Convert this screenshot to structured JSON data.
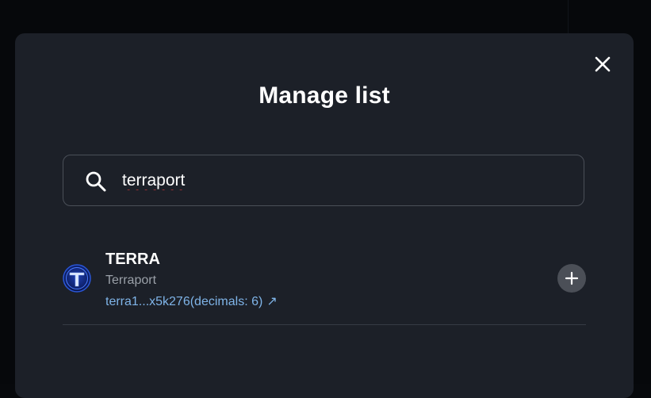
{
  "modal": {
    "title": "Manage list",
    "close_icon": "close-icon"
  },
  "search": {
    "value": "terraport",
    "icon": "search-icon"
  },
  "results": [
    {
      "symbol": "TERRA",
      "name": "Terraport",
      "address_text": "terra1...x5k276(decimals: 6)",
      "link_icon": "external-link-arrow-icon",
      "logo_letter": "T",
      "add_icon": "plus-icon"
    }
  ],
  "colors": {
    "modal_bg": "#1c2028",
    "link": "#7fb4e8",
    "secondary_text": "#9aa0a8",
    "add_button_bg": "#4b4f57"
  }
}
